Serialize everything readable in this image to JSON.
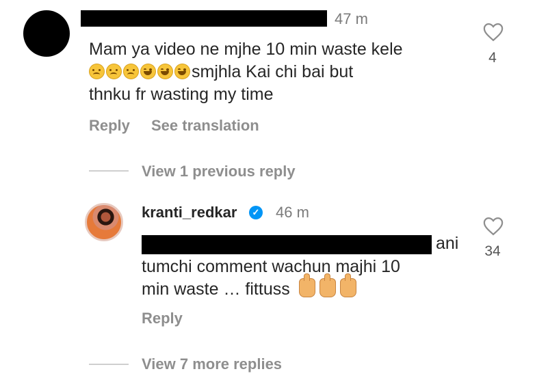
{
  "comment1": {
    "time": "47 m",
    "line1": "Mam ya video ne mjhe 10 min waste kele",
    "line2_emojis": [
      "sad",
      "sad",
      "sad",
      "laugh",
      "laugh",
      "laugh"
    ],
    "line2_text": "smjhla Kai chi bai but",
    "line3": "thnku fr wasting my time",
    "like_count": "4",
    "reply_label": "Reply",
    "see_translation_label": "See translation"
  },
  "view_previous": "View 1 previous reply",
  "comment2": {
    "username": "kranti_redkar",
    "time": "46 m",
    "line1_tail": "ani",
    "line2": "tumchi comment wachun majhi 10",
    "line3": "min waste … fittuss",
    "like_count": "34",
    "reply_label": "Reply"
  },
  "view_more": "View 7 more replies"
}
